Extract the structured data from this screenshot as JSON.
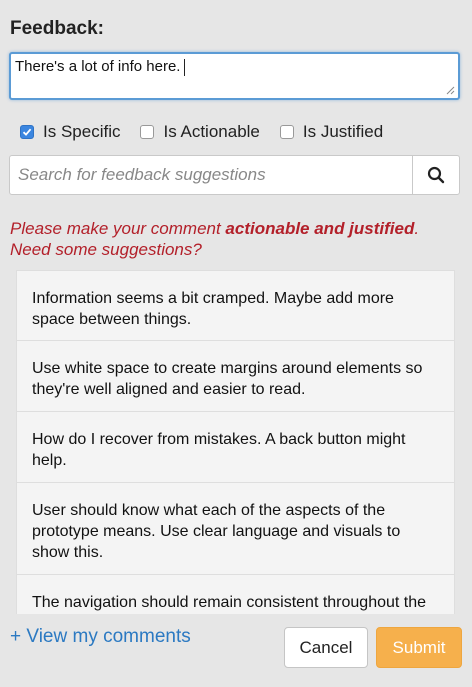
{
  "header": {
    "title": "Feedback:"
  },
  "comment": {
    "value": "There's a lot of info here."
  },
  "checkboxes": [
    {
      "label": "Is Specific",
      "checked": true
    },
    {
      "label": "Is Actionable",
      "checked": false
    },
    {
      "label": "Is Justified",
      "checked": false
    }
  ],
  "search": {
    "placeholder": "Search for feedback suggestions",
    "icon": "search-icon"
  },
  "warning": {
    "prefix": "Please make your comment ",
    "emphasis": "actionable and justified",
    "suffix": ".",
    "line2": "Need some suggestions?"
  },
  "suggestions": [
    "Information seems a bit cramped. Maybe add more space between things.",
    "Use white space to create margins around elements so they're well aligned and easier to read.",
    "How do I recover from mistakes. A back button might help.",
    "User should know what each of the aspects of the prototype means. Use clear language and visuals to show this.",
    "The navigation should remain consistent throughout the prototype so the user can easily find their way."
  ],
  "footer": {
    "view_comments": "+ View my comments",
    "cancel": "Cancel",
    "submit": "Submit"
  },
  "colors": {
    "accent": "#3b86e0",
    "warning": "#b3202a",
    "link": "#2b79c2",
    "submit": "#f6b04c"
  }
}
